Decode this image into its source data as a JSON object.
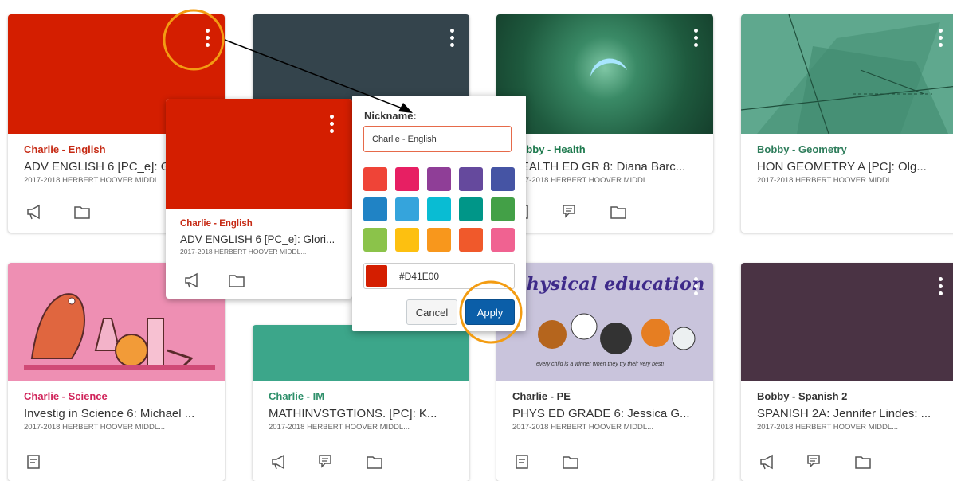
{
  "colors": {
    "red": "#D41E00",
    "slate": "#34444C",
    "green": "#1E5A3E",
    "geometry": "#5FA88E",
    "pink": "#EE8FB3",
    "teal": "#3CA68A",
    "pe_purple": "#C9C4DC",
    "plum": "#4A3344",
    "apply_blue": "#0B5EA8",
    "accent_orange": "#F39C12"
  },
  "cards": [
    {
      "nickname": "Charlie - English",
      "name": "ADV ENGLISH 6 [PC_e]: Glori...",
      "term": "2017-2018 HERBERT HOOVER MIDDL...",
      "nick_color": "#C62A14"
    },
    {
      "nickname": "",
      "name": "",
      "term": "",
      "nick_color": "#34444C"
    },
    {
      "nickname": "Bobby - Health",
      "name": "HEALTH ED GR 8: Diana Barc...",
      "term": "2017-2018 HERBERT HOOVER MIDDL...",
      "nick_color": "#1E7A4E"
    },
    {
      "nickname": "Bobby - Geometry",
      "name": "HON GEOMETRY A [PC]: Olg...",
      "term": "2017-2018 HERBERT HOOVER MIDDL...",
      "nick_color": "#2E7D5B"
    },
    {
      "nickname": "Charlie - Science",
      "name": "Investig in Science 6: Michael ...",
      "term": "2017-2018 HERBERT HOOVER MIDDL...",
      "nick_color": "#D0245A"
    },
    {
      "nickname": "Charlie - IM",
      "name": "MATHINVSTGTIONS. [PC]: K...",
      "term": "2017-2018 HERBERT HOOVER MIDDL...",
      "nick_color": "#2E8F6A"
    },
    {
      "nickname": "Charlie - PE",
      "name": "PHYS ED GRADE 6: Jessica G...",
      "term": "2017-2018 HERBERT HOOVER MIDDL...",
      "nick_color": "#333333"
    },
    {
      "nickname": "Bobby - Spanish 2",
      "name": "SPANISH 2A: Jennifer Lindes: ...",
      "term": "2017-2018 HERBERT HOOVER MIDDL...",
      "nick_color": "#333333"
    }
  ],
  "preview": {
    "nickname": "Charlie - English",
    "name": "ADV ENGLISH 6 [PC_e]: Glori...",
    "term": "2017-2018 HERBERT HOOVER MIDDL..."
  },
  "picker": {
    "label": "Nickname:",
    "nickname_value": "Charlie - English",
    "hex_value": "#D41E00",
    "cancel_label": "Cancel",
    "apply_label": "Apply",
    "swatches": [
      "#EF4437",
      "#E71F63",
      "#8F3E97",
      "#65499D",
      "#4554A4",
      "#2083C5",
      "#35A4DC",
      "#09BCD3",
      "#009688",
      "#43A047",
      "#8BC34A",
      "#FDC010",
      "#F8971C",
      "#F0592B",
      "#F06291"
    ]
  },
  "pe_banner": {
    "title": "physical education",
    "motto": "every child is a winner when they try their very best!"
  }
}
